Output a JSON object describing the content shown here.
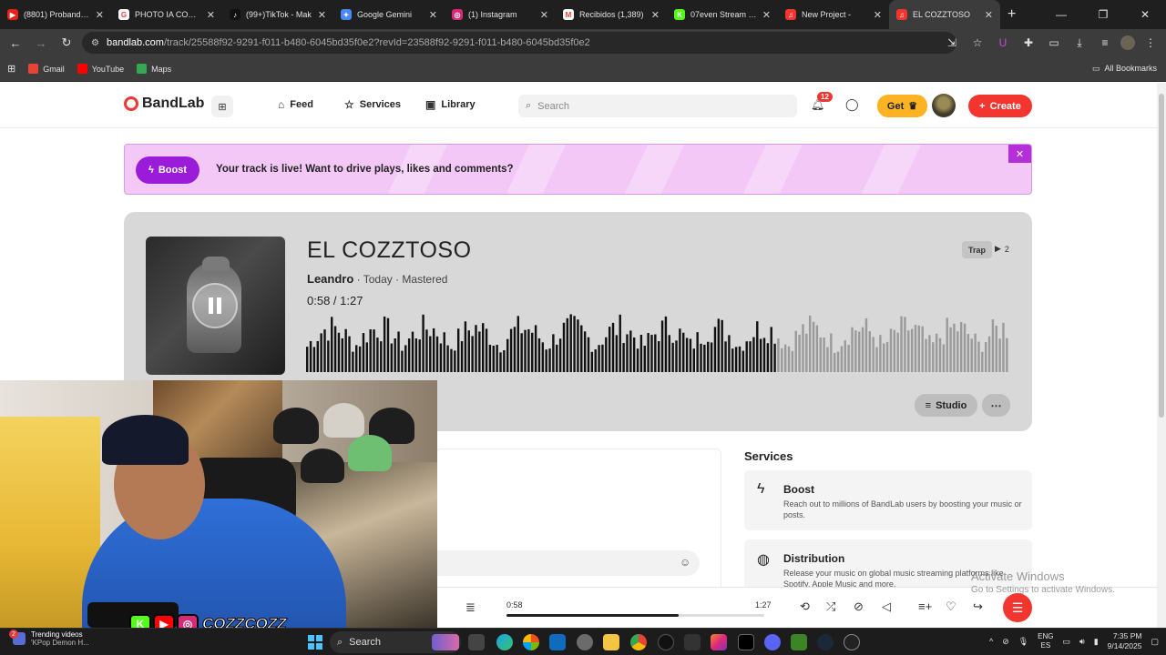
{
  "browser": {
    "tabs": [
      {
        "title": "(8801) Probando c",
        "favicon_color": "#e62117",
        "favicon_glyph": "▶"
      },
      {
        "title": "PHOTO IA CON AI",
        "favicon_color": "#ffffff",
        "favicon_glyph": "G"
      },
      {
        "title": "(99+)TikTok - Mak",
        "favicon_color": "#111111",
        "favicon_glyph": "♪"
      },
      {
        "title": "Google Gemini",
        "favicon_color": "#4b88f7",
        "favicon_glyph": "✦"
      },
      {
        "title": "(1) Instagram",
        "favicon_color": "#d62976",
        "favicon_glyph": "◎"
      },
      {
        "title": "Recibidos (1,389)",
        "favicon_color": "#ffffff",
        "favicon_glyph": "M"
      },
      {
        "title": "07even Stream - V",
        "favicon_color": "#53fc18",
        "favicon_glyph": "K"
      },
      {
        "title": "New Project -",
        "favicon_color": "#f2362f",
        "favicon_glyph": "♫"
      },
      {
        "title": "EL COZZTOSO",
        "favicon_color": "#f2362f",
        "favicon_glyph": "♫"
      }
    ],
    "url_host": "bandlab.com",
    "url_path": "/track/25588f92-9291-f011-b480-6045bd35f0e2?revId=23588f92-9291-f011-b480-6045bd35f0e2",
    "bookmarks": [
      {
        "label": "Gmail",
        "color": "#ea4335"
      },
      {
        "label": "YouTube",
        "color": "#ff0000"
      },
      {
        "label": "Maps",
        "color": "#34a853"
      }
    ],
    "all_bookmarks_label": "All Bookmarks"
  },
  "bandlab": {
    "logo": "BandLab",
    "nav": {
      "feed": "Feed",
      "services": "Services",
      "library": "Library"
    },
    "search_placeholder": "Search",
    "notifications_count": "12",
    "get_label": "Get",
    "create_label": "Create",
    "banner": {
      "boost_label": "Boost",
      "text": "Your track is live! Want to drive plays, likes and comments?"
    },
    "track": {
      "title": "EL COZZTOSO",
      "artist": "Leandro",
      "meta_rest": " · Today · Mastered",
      "current_time": "0:58",
      "separator": " /  ",
      "duration": "1:27",
      "genre": "Trap",
      "plays": "2",
      "played_fraction": 0.667,
      "studio_label": "Studio",
      "more_label": "⋯"
    },
    "services_title": "Services",
    "services": [
      {
        "name": "Boost",
        "icon": "bolt-icon",
        "glyph": "ϟ",
        "description": "Reach out to millions of BandLab users by boosting your music or posts."
      },
      {
        "name": "Distribution",
        "icon": "globe-icon",
        "glyph": "◍",
        "description": "Release your music on global music streaming platforms like Spotify, Apple Music and more."
      }
    ],
    "player": {
      "current": "0:58",
      "duration": "1:27",
      "progress": 0.667
    }
  },
  "watermark": {
    "line1": "Activate Windows",
    "line2": "Go to Settings to activate Windows."
  },
  "overlay": {
    "handle": "COZZCOZZ",
    "socials": [
      {
        "glyph": "K",
        "color": "#53fc18"
      },
      {
        "glyph": "▶",
        "color": "#ff0000"
      },
      {
        "glyph": "◎",
        "color": "#d62976"
      }
    ]
  },
  "taskbar": {
    "widget_badge": "2",
    "widget_title": "Trending videos",
    "widget_sub": "'KPop Demon H...",
    "search_label": "Search",
    "lang_line1": "ENG",
    "lang_line2": "ES",
    "time": "7:35 PM",
    "date": "9/14/2025"
  },
  "colors": {
    "accent": "#f2362f",
    "boost_purple": "#9a1bd8",
    "banner_bg": "#f3c8f7",
    "card_bg": "#d8d8d8"
  }
}
